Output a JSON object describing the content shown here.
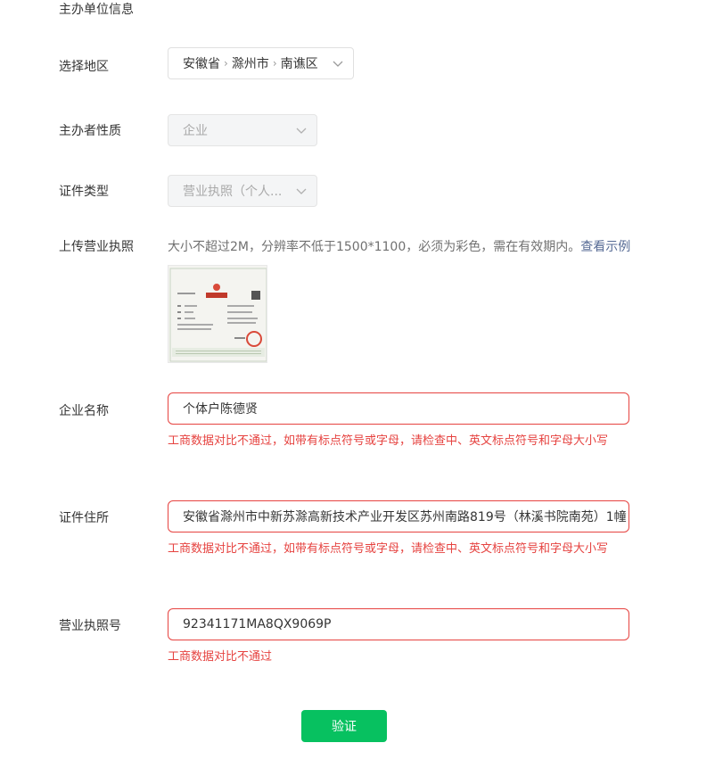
{
  "section_title": "主办单位信息",
  "region": {
    "label": "选择地区",
    "province": "安徽省",
    "city": "滁州市",
    "district": "南谯区"
  },
  "organizer_type": {
    "label": "主办者性质",
    "value": "企业"
  },
  "certificate_type": {
    "label": "证件类型",
    "value": "营业执照（个人..."
  },
  "upload": {
    "label": "上传营业执照",
    "hint": "大小不超过2M，分辨率不低于1500*1100，必须为彩色，需在有效期内。",
    "example_link": "查看示例",
    "thumbnail_title": "营业执照"
  },
  "company_name": {
    "label": "企业名称",
    "value": "个体户陈德贤",
    "error": "工商数据对比不通过，如带有标点符号或字母，请检查中、英文标点符号和字母大小写"
  },
  "address": {
    "label": "证件住所",
    "value": "安徽省滁州市中新苏滁高新技术产业开发区苏州南路819号（林溪书院南苑）1幢",
    "error": "工商数据对比不通过，如带有标点符号或字母，请检查中、英文标点符号和字母大小写"
  },
  "license_no": {
    "label": "营业执照号",
    "value": "92341171MA8QX9069P",
    "error": "工商数据对比不通过"
  },
  "verify_button": "验证",
  "colors": {
    "primary": "#07c160",
    "error": "#e64340",
    "link": "#576b95"
  }
}
